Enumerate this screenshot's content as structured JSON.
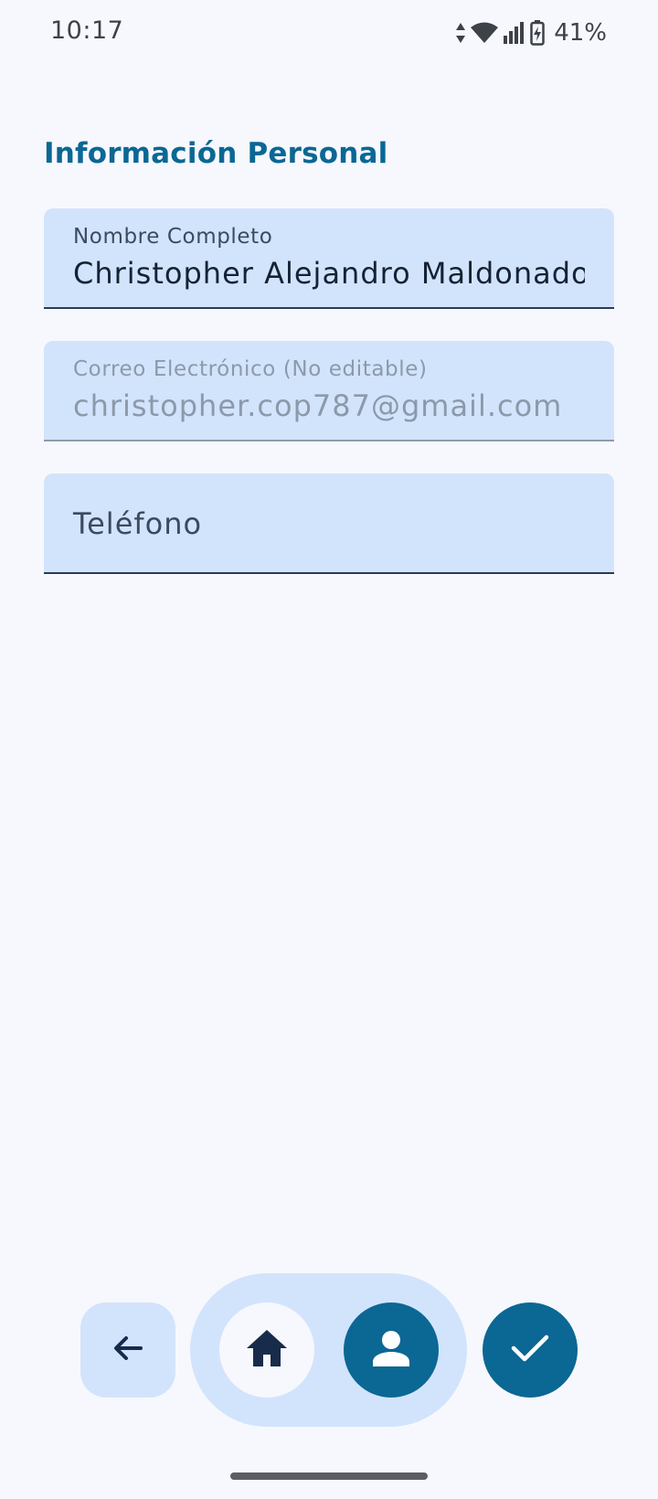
{
  "status_bar": {
    "time": "10:17",
    "battery_percent": "41%",
    "icons": [
      "data-arrows-icon",
      "wifi-icon",
      "signal-icon",
      "battery-charging-icon"
    ]
  },
  "section": {
    "title": "Información Personal"
  },
  "fields": {
    "name": {
      "label": "Nombre Completo",
      "value": "Christopher Alejandro Maldonado"
    },
    "email": {
      "label": "Correo Electrónico (No editable)",
      "value": "christopher.cop787@gmail.com"
    },
    "phone": {
      "placeholder": "Teléfono"
    }
  },
  "bottom_nav": {
    "buttons": [
      "back-arrow-icon",
      "home-icon",
      "person-icon",
      "check-icon"
    ],
    "selected": "profile"
  },
  "colors": {
    "background": "#f7f8fe",
    "accent": "#0b6794",
    "field_bg": "#d2e4fc",
    "dark_icon": "#172b4a"
  }
}
